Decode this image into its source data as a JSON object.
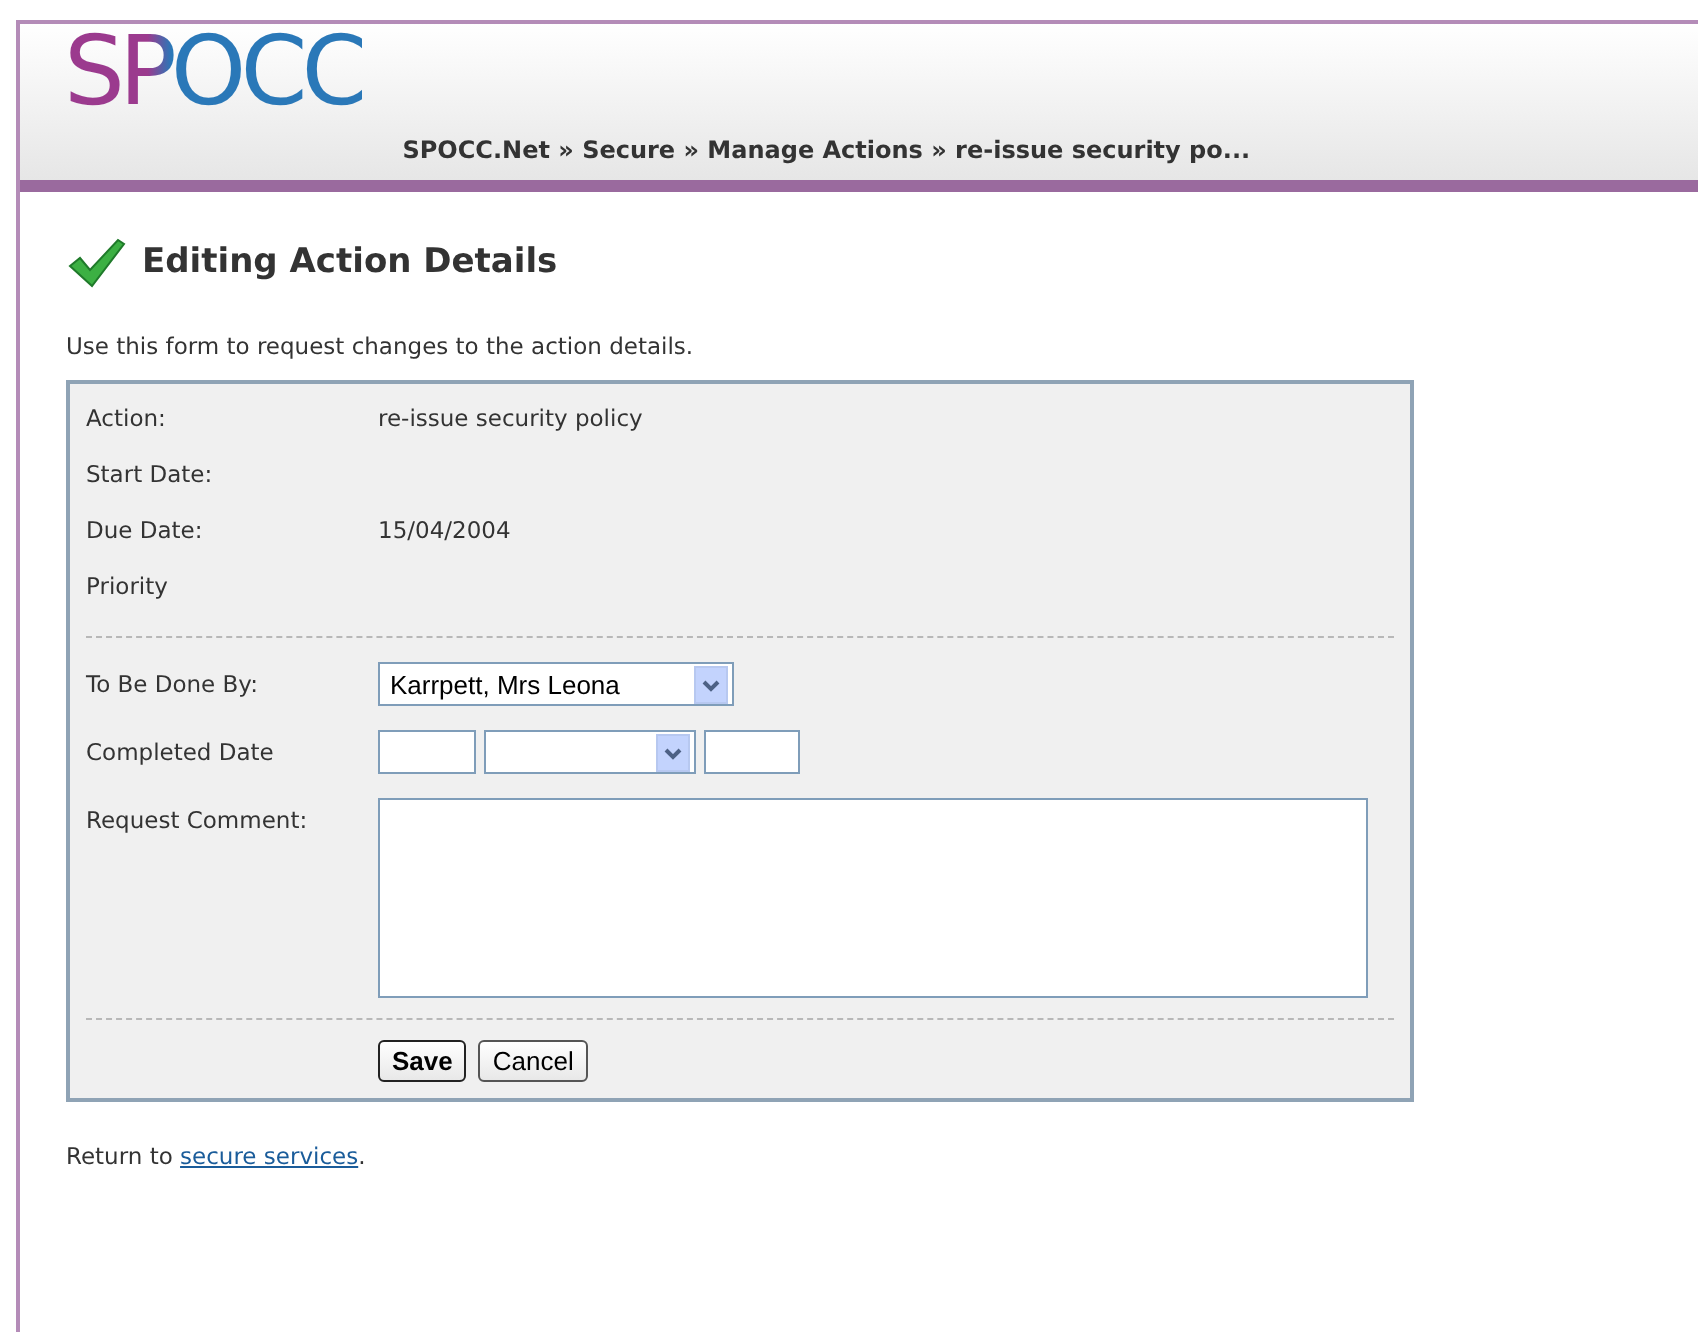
{
  "header": {
    "logo": "SPOCC",
    "breadcrumb": "SPOCC.Net » Secure » Manage Actions » re-issue security po..."
  },
  "title": "Editing Action Details",
  "intro": "Use this form to request changes to the action details.",
  "details": [
    {
      "label": "Action:",
      "value": "re-issue security policy"
    },
    {
      "label": "Start Date:"
    },
    {
      "label": "Due Date:",
      "value": "15/04/2004"
    },
    {
      "label": "Priority"
    }
  ],
  "fields": [
    {
      "kind": "select",
      "label": "To Be Done By:",
      "value": "Karrpett, Mrs Leona"
    },
    {
      "kind": "date",
      "label": "Completed Date"
    },
    {
      "kind": "textarea",
      "label": "Request Comment:"
    }
  ],
  "buttons": [
    {
      "label": "Save",
      "default": true
    },
    {
      "label": "Cancel",
      "default": false
    }
  ],
  "footer": {
    "prefix": "Return to ",
    "link": "secure services",
    "suffix": "."
  }
}
